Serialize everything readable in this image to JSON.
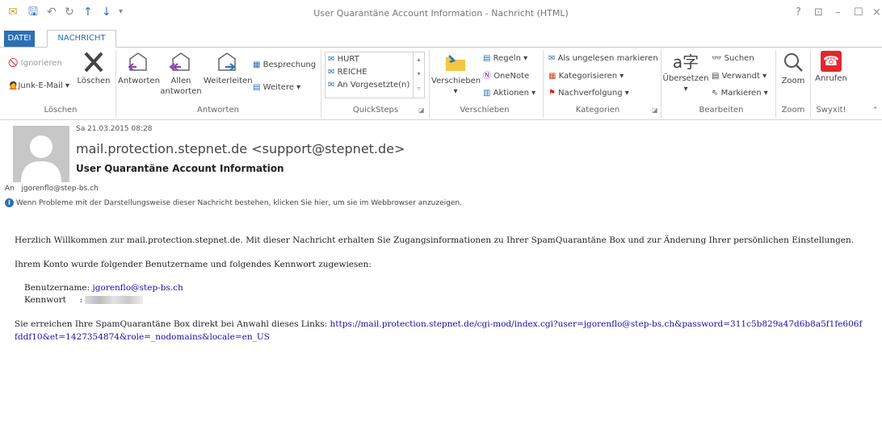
{
  "window": {
    "title": "User Quarantäne Account Information - Nachricht (HTML)",
    "controls": [
      "?",
      "⊡",
      "–",
      "☐",
      "×"
    ]
  },
  "tabs": [
    {
      "label": "DATEI",
      "active": false
    },
    {
      "label": "NACHRICHT",
      "active": true
    }
  ],
  "ribbon": {
    "loeschen": {
      "label": "Löschen",
      "ignorieren": "Ignorieren",
      "junk": "Junk-E-Mail",
      "loeschen_btn": "Löschen"
    },
    "antworten": {
      "label": "Antworten",
      "antworten_btn": "Antworten",
      "allen_1": "Allen",
      "allen_2": "antworten",
      "weiterleiten": "Weiterleiten",
      "besprechung": "Besprechung",
      "weitere": "Weitere"
    },
    "quicksteps": {
      "label": "QuickSteps",
      "items": [
        "HURT",
        "REICHE",
        "An Vorgesetzte(n)"
      ]
    },
    "verschieben": {
      "label": "Verschieben",
      "verschieben_btn": "Verschieben",
      "regeln": "Regeln",
      "onenote": "OneNote",
      "aktionen": "Aktionen"
    },
    "kategorien": {
      "label": "Kategorien",
      "ungelesen": "Als ungelesen markieren",
      "kategorisieren": "Kategorisieren",
      "nachverfolgung": "Nachverfolgung"
    },
    "bearbeiten": {
      "label": "Bearbeiten",
      "uebersetzen": "Übersetzen",
      "suchen": "Suchen",
      "verwandt": "Verwandt",
      "markieren": "Markieren"
    },
    "zoom": {
      "label": "Zoom",
      "zoom_btn": "Zoom"
    },
    "swyxit": {
      "label": "Swyxit!",
      "anrufen": "Anrufen"
    }
  },
  "email": {
    "date": "Sa 21.03.2015 08:28",
    "sender": "mail.protection.stepnet.de <support@stepnet.de>",
    "subject": "User Quarantäne Account Information",
    "to_label": "An",
    "to": "jgorenflo@step-bs.ch",
    "info": "Wenn Probleme mit der Darstellungsweise dieser Nachricht bestehen, klicken Sie hier, um sie im Webbrowser anzuzeigen.",
    "body": {
      "p1": "Herzlich Willkommen zur mail.protection.stepnet.de.  Mit dieser Nachricht erhalten Sie Zugangsinformationen zu Ihrer SpamQuarantäne Box und zur Änderung Ihrer persönlichen Einstellungen.",
      "p2": "Ihrem Konto wurde folgender Benutzername und folgendes Kennwort zugewiesen:",
      "user_label": "Benutzername:",
      "user_value": "jgorenflo@step-bs.ch",
      "pass_label": "Kennwort",
      "pass_sep": ":",
      "p3": "Sie erreichen Ihre SpamQuarantäne Box direkt bei Anwahl dieses Links:",
      "link": "https://mail.protection.stepnet.de/cgi-mod/index.cgi?user=jgorenflo@step-bs.ch&password=311c5b829a47d6b8a5f1fe606ffddf10&et=1427354874&role=_nodomains&locale=en_US"
    }
  },
  "colors": {
    "accent": "#2b6fb6",
    "link": "#1a0dab",
    "swyx_red": "#e0282e"
  }
}
